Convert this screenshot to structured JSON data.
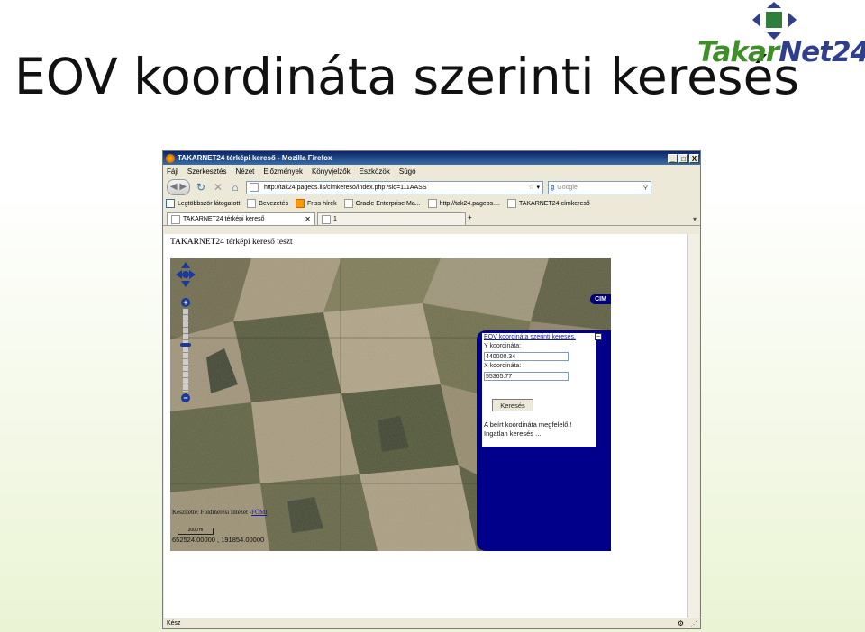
{
  "slide": {
    "title": "EOV koordináta szerinti keresés",
    "logo": {
      "text_part1": "Takar",
      "text_part2": "Net24"
    }
  },
  "browser": {
    "window_title": "TAKARNET24 térképi kereső - Mozilla Firefox",
    "window_buttons": [
      "_",
      "□",
      "X"
    ],
    "menu": [
      "Fájl",
      "Szerkesztés",
      "Nézet",
      "Előzmények",
      "Könyvjelzők",
      "Eszközök",
      "Súgó"
    ],
    "url": "http://tak24.pageos.lis/cimkereso/index.php?sid=111AASS",
    "search_placeholder": "Google",
    "bookmarks": [
      "Legtöbbször látogatott",
      "Bevezetés",
      "Friss hírek",
      "Oracle Enterprise Ma...",
      "http://tak24.pageos....",
      "TAKARNET24 címkereső"
    ],
    "tabs": [
      {
        "label": "TAKARNET24 térképi kereső",
        "active": true
      },
      {
        "label": "1",
        "active": false
      }
    ],
    "status": "Kész"
  },
  "page": {
    "heading": "TAKARNET24 térképi kereső teszt",
    "cim_button": "CIM",
    "eov_panel": {
      "title": "EOV koordináta szerinti keresés.",
      "y_label": "Y koordináta:",
      "y_value": "440000.34",
      "x_label": "X koordináta:",
      "x_value": "55365.77",
      "search_button": "Keresés",
      "message": "A beírt koordináta megfelelő !",
      "status": "Ingatlan keresés ..."
    },
    "credit_prefix": "Készítette: Földmérési Intézet -",
    "credit_link": "FÖMI",
    "scale_label": "2000 m",
    "coordinates": "652524.00000 , 191854.00000"
  },
  "colors": {
    "panel_blue": "#00008b",
    "logo_green": "#3e8e2a",
    "logo_blue": "#2f3f8c"
  }
}
